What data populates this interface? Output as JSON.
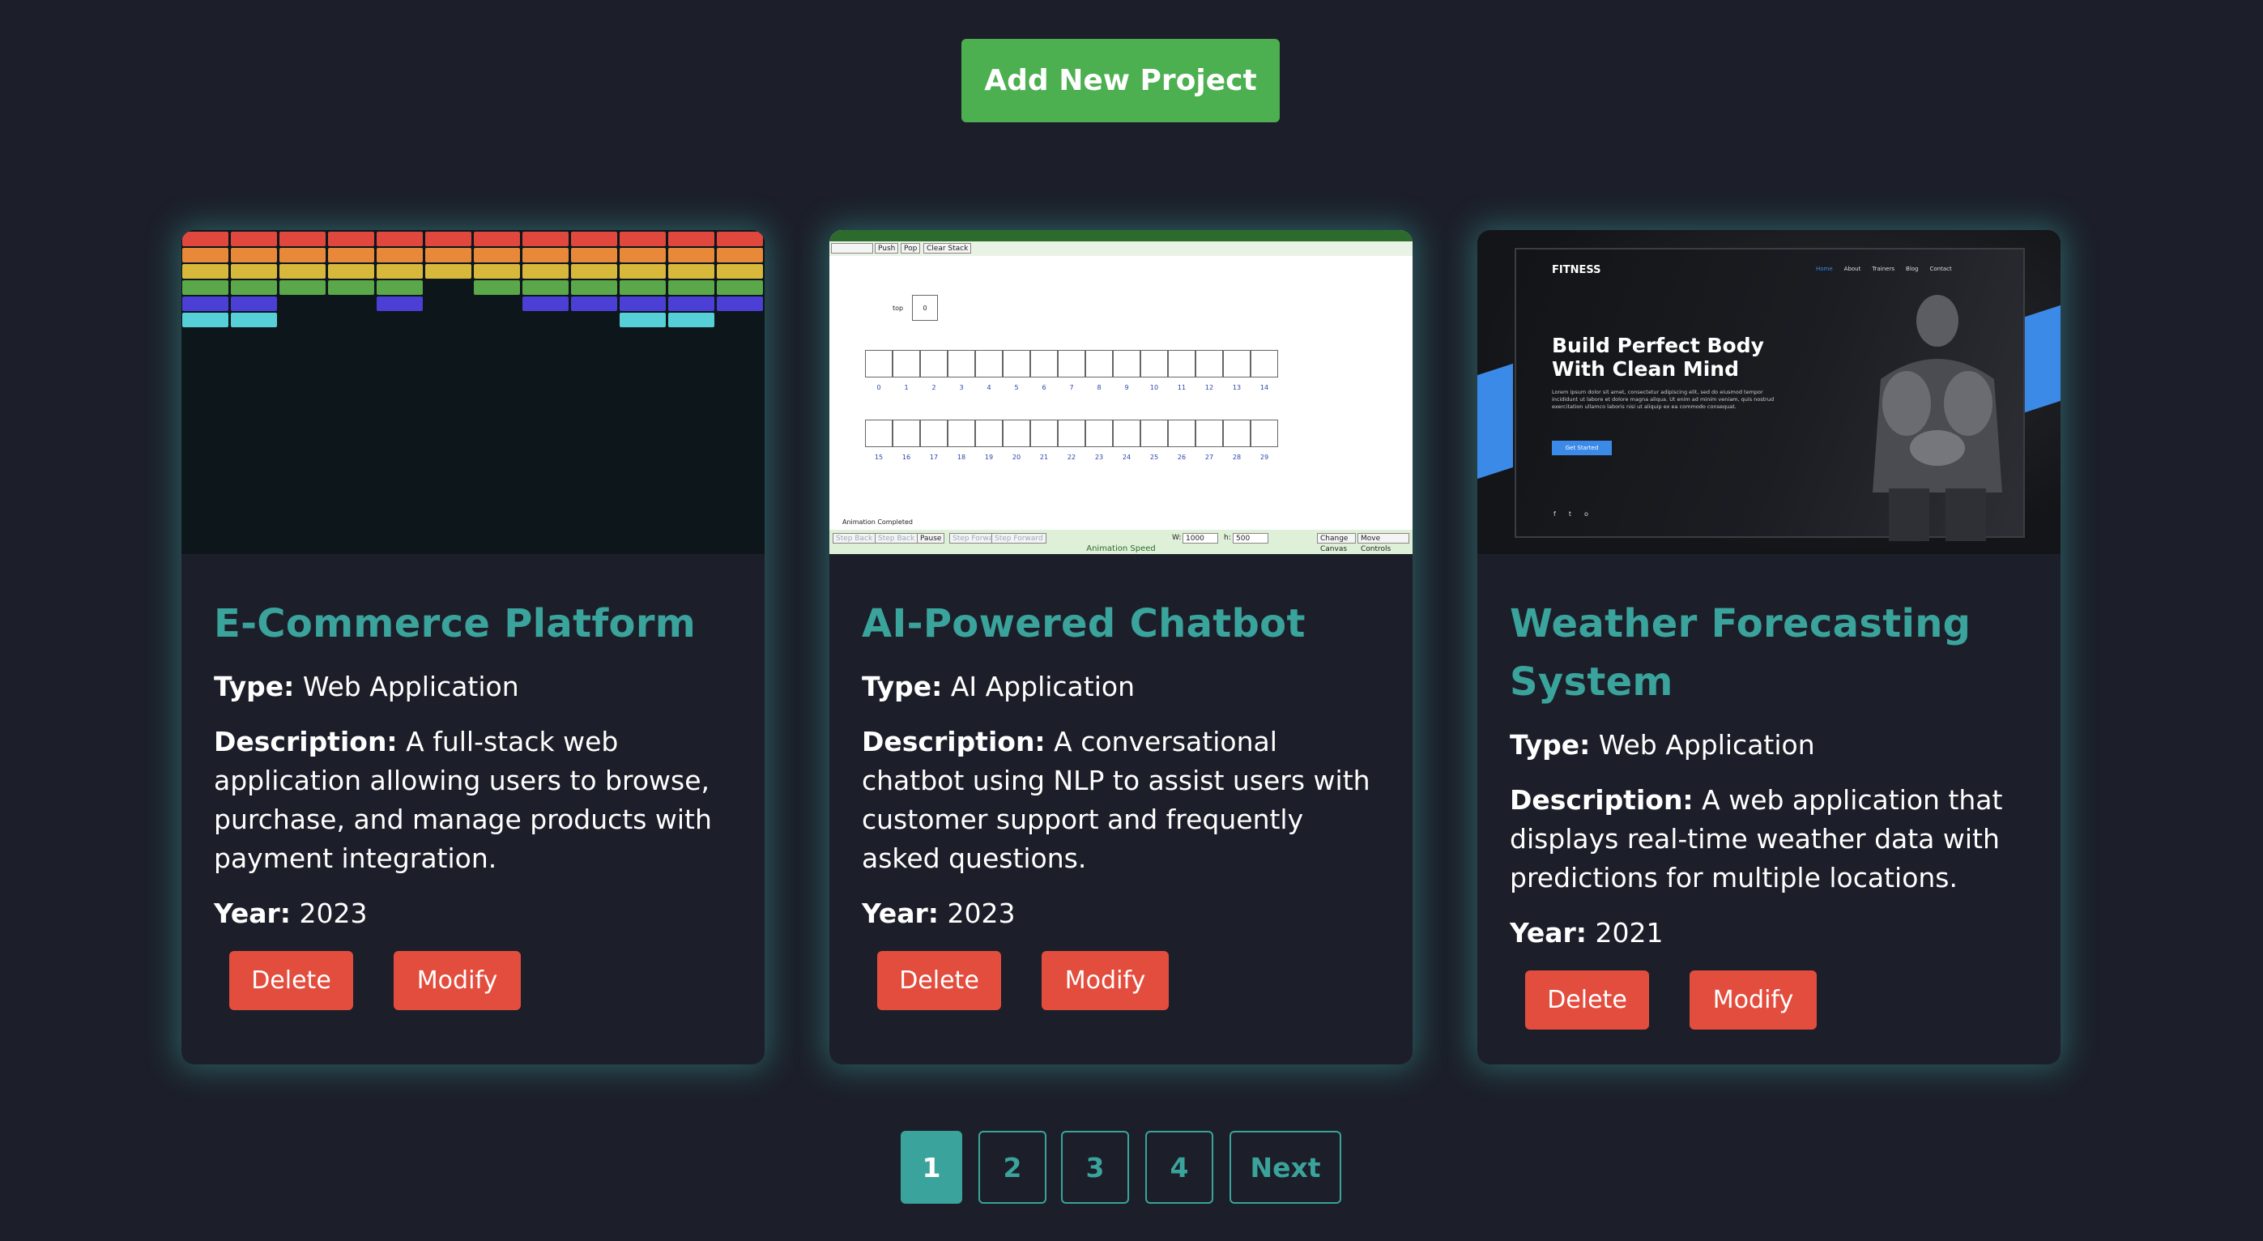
{
  "header": {
    "add_label": "Add New Project"
  },
  "labels": {
    "type": "Type:",
    "description": "Description:",
    "year": "Year:"
  },
  "cards": [
    {
      "title": "E-Commerce Platform",
      "type": "Web Application",
      "description": "A full-stack web application allowing users to browse, purchase, and manage products with payment integration.",
      "year": "2023",
      "delete_label": "Delete",
      "modify_label": "Modify"
    },
    {
      "title": "AI-Powered Chatbot",
      "type": "AI Application",
      "description": "A conversational chatbot using NLP to assist users with customer support and frequently asked questions.",
      "year": "2023",
      "delete_label": "Delete",
      "modify_label": "Modify"
    },
    {
      "title": "Weather Forecasting System",
      "type": "Web Application",
      "description": "A web application that displays real-time weather data with predictions for multiple locations.",
      "year": "2021",
      "delete_label": "Delete",
      "modify_label": "Modify"
    }
  ],
  "thumb_viz": {
    "push": "Push",
    "pop": "Pop",
    "clear": "Clear Stack",
    "top_label": "top",
    "top_value": "0",
    "status": "Animation Completed",
    "speed": "Animation Speed",
    "controls": [
      "Step Back",
      "Step Back",
      "Pause",
      "Step Forward",
      "Step Forward"
    ],
    "w_label": "W:",
    "w_value": "1000",
    "h_label": "h:",
    "h_value": "500",
    "change_size": "Change Canvas Size",
    "move_controls": "Move Controls",
    "row1": [
      "0",
      "1",
      "2",
      "3",
      "4",
      "5",
      "6",
      "7",
      "8",
      "9",
      "10",
      "11",
      "12",
      "13",
      "14"
    ],
    "row2": [
      "15",
      "16",
      "17",
      "18",
      "19",
      "20",
      "21",
      "22",
      "23",
      "24",
      "25",
      "26",
      "27",
      "28",
      "29"
    ]
  },
  "thumb_fitness": {
    "brand": "FITNESS",
    "nav": [
      "Home",
      "About",
      "Trainers",
      "Blog",
      "Contact"
    ],
    "headline_1": "Build Perfect Body",
    "headline_2": "With Clean Mind",
    "blurb": "Lorem ipsum dolor sit amet, consectetur adipiscing elit, sed do eiusmod tempor incididunt ut labore et dolore magna aliqua. Ut enim ad minim veniam, quis nostrud exercitation ullamco laboris nisi ut aliquip ex ea commodo consequat.",
    "cta": "Get Started",
    "social": [
      "f",
      "t",
      "o"
    ]
  },
  "pagination": {
    "pages": [
      "1",
      "2",
      "3",
      "4"
    ],
    "current": "1",
    "next_label": "Next"
  },
  "colors": {
    "accent": "#3aa39c",
    "add_button": "#4caf50",
    "danger": "#e34d3e",
    "background": "#1c1f29"
  }
}
